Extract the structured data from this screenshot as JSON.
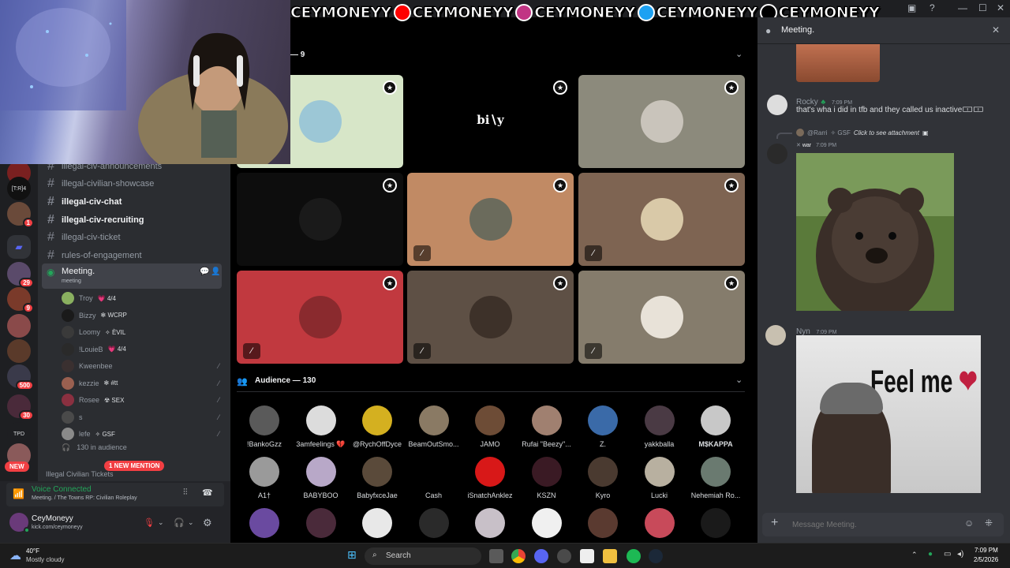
{
  "overlay": {
    "items": [
      {
        "icon": "kick-icon",
        "handle": "CEYMONEYY",
        "color": "#53fc18"
      },
      {
        "icon": "youtube-icon",
        "handle": "CEYMONEYY",
        "color": "#ff0000"
      },
      {
        "icon": "instagram-icon",
        "handle": "CEYMONEYY",
        "color": "#c13584"
      },
      {
        "icon": "twitter-icon",
        "handle": "CEYMONEYY",
        "color": "#1da1f2"
      },
      {
        "icon": "tiktok-icon",
        "handle": "CEYMONEYY",
        "color": "#000000"
      }
    ]
  },
  "servers": {
    "badges": [
      "29",
      "1",
      "9",
      "500",
      "30"
    ],
    "label_trp": "[T:R]4",
    "label_tpd": "TPD",
    "new_label": "NEW"
  },
  "channels": {
    "items": [
      {
        "name": "illegal-civ-announcements",
        "bold": false
      },
      {
        "name": "illegal-civilian-showcase",
        "bold": false
      },
      {
        "name": "illegal-civ-chat",
        "bold": true
      },
      {
        "name": "illegal-civ-recruiting",
        "bold": true
      },
      {
        "name": "illegal-civ-ticket",
        "bold": false
      },
      {
        "name": "rules-of-engagement",
        "bold": false
      }
    ],
    "stage": {
      "name": "Meeting.",
      "subtitle": "meeting"
    },
    "voice_users": [
      {
        "name": "Troy",
        "tag": "💗 4/4",
        "muted": false
      },
      {
        "name": "Bizzy",
        "tag": "✻ WCRP",
        "muted": false
      },
      {
        "name": "Loomy",
        "tag": "✧ ÈVIL",
        "muted": false
      },
      {
        "name": "!LouieB",
        "tag": "💗 4/4",
        "muted": false
      },
      {
        "name": "Kweenbee",
        "tag": "",
        "muted": true
      },
      {
        "name": "kezzie",
        "tag": "✻ #tt",
        "muted": true
      },
      {
        "name": "Rosee",
        "tag": "☢ SEX",
        "muted": true
      },
      {
        "name": "s",
        "tag": "",
        "muted": true
      },
      {
        "name": "lefe",
        "tag": "✧ GSF",
        "muted": true
      }
    ],
    "audience_count": "130 in audience",
    "mention_pill": "1 NEW MENTION",
    "category": "Illegal Civilian Tickets"
  },
  "voice": {
    "status": "Voice Connected",
    "location": "Meeting. / The Towns RP: Civilian Roleplay",
    "user_name": "CeyMoneyy",
    "user_status": "kick.com/ceymoneyy"
  },
  "stage": {
    "speakers_header": "— 9",
    "speaker_tiles": [
      {
        "bg": "#d7e6c8",
        "avatar": "#9cc7d6",
        "label": "",
        "muted": false
      },
      {
        "bg": "#000000",
        "avatar": "",
        "label": "bi∖y",
        "muted": false
      },
      {
        "bg": "#8c8a7c",
        "avatar": "#c9c4bb",
        "label": "",
        "muted": false
      },
      {
        "bg": "#0d0d0d",
        "avatar": "#1a1a1a",
        "label": "",
        "muted": false
      },
      {
        "bg": "#c18a64",
        "avatar": "#6b6b5c",
        "label": "",
        "muted": true
      },
      {
        "bg": "#7e6452",
        "avatar": "#d9c9a8",
        "label": "",
        "muted": true
      },
      {
        "bg": "#c1393f",
        "avatar": "#8a2a2e",
        "label": "",
        "muted": true
      },
      {
        "bg": "#5e5045",
        "avatar": "#3d3129",
        "label": "",
        "muted": true
      },
      {
        "bg": "#857c6c",
        "avatar": "#e8e2d8",
        "label": "",
        "muted": true
      }
    ],
    "audience_header": "Audience — 130",
    "audience": [
      {
        "name": "!BankoGzz",
        "color": "#5a5a5a",
        "bold": false
      },
      {
        "name": "3amfeelings 💔",
        "color": "#dcdcdc",
        "bold": false
      },
      {
        "name": "@RychOffDyce",
        "color": "#d4b020",
        "bold": false
      },
      {
        "name": "BeamOutSmo...",
        "color": "#8a7a64",
        "bold": false
      },
      {
        "name": "JAMO",
        "color": "#6d4c36",
        "bold": false
      },
      {
        "name": "Rufai \"Beezy\"...",
        "color": "#a08070",
        "bold": false
      },
      {
        "name": "Z.",
        "color": "#3a6aa8",
        "bold": false
      },
      {
        "name": "yakkballa",
        "color": "#4a3a44",
        "bold": false
      },
      {
        "name": "M$KAPPA",
        "color": "#c8c8c8",
        "bold": true
      },
      {
        "name": "A1†",
        "color": "#9a9a9a",
        "bold": false
      },
      {
        "name": "BABYBOO",
        "color": "#b8a8c8",
        "bold": false
      },
      {
        "name": "BabyfxceJae",
        "color": "#5a4a3a",
        "bold": false
      },
      {
        "name": "Cash",
        "color": "#000000",
        "bold": false
      },
      {
        "name": "iSnatchAnklez",
        "color": "#d81818",
        "bold": false
      },
      {
        "name": "KSZN",
        "color": "#3a1a24",
        "bold": false
      },
      {
        "name": "Kyro",
        "color": "#4a3a30",
        "bold": false
      },
      {
        "name": "Lucki",
        "color": "#b8b0a0",
        "bold": false
      },
      {
        "name": "Nehemiah Ro...",
        "color": "#6a7a70",
        "bold": false
      }
    ],
    "row3_colors": [
      "#6a4aa0",
      "#4a2a3a",
      "#e8e8e8",
      "#2a2a2a",
      "#c8c0c8",
      "#f0f0f0",
      "#5a3a30",
      "#c84a5a",
      "#1a1a1a"
    ]
  },
  "chat": {
    "title": "Meeting.",
    "messages": [
      {
        "author": "Rocky",
        "time": "7:09 PM",
        "text": "that's wha i did in tfb and they called us inactive🀱🀱"
      },
      {
        "reply_to": "@Rarri",
        "reply_tag": "✧ GSF",
        "reply_text": "Click to see attachment",
        "author": "war",
        "time": "7:09 PM"
      },
      {
        "author": "Nyn",
        "time": "7:09 PM",
        "image_caption": "Feel me"
      }
    ],
    "input_placeholder": "Message Meeting."
  },
  "taskbar": {
    "weather_temp": "40°F",
    "weather_desc": "Mostly cloudy",
    "search_label": "Search",
    "time": "7:09 PM",
    "date": "2/5/2026"
  }
}
